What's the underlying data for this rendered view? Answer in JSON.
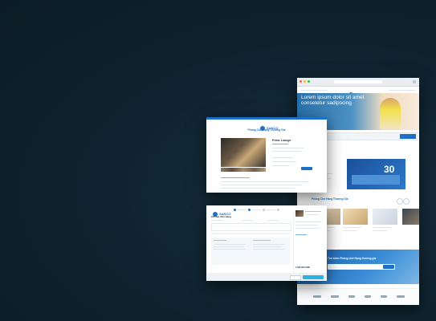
{
  "main_site": {
    "brand": "SANCO",
    "hero_heading": "Lorem ipsum dolor sit amet consetetur sadipscing",
    "promo_number": "30",
    "section_title": "Phòng Chờ Hạng Thương Gia",
    "search_banner_title": "Tìm kiếm Phòng chờ Hạng thương gia"
  },
  "detail_page": {
    "brand": "SANCO",
    "heading": "Phòng Chờ Hạng Thương Gia",
    "lounge_name": "Prime Lounge"
  },
  "checkout_page": {
    "brand": "SANCO",
    "section_heading": "Chi tiết đơn hàng",
    "total_value": "1.000.000 VND"
  },
  "colors": {
    "background": "#0f2430",
    "brand_blue": "#1e6fc8",
    "accent_cyan": "#2bb3e0"
  }
}
